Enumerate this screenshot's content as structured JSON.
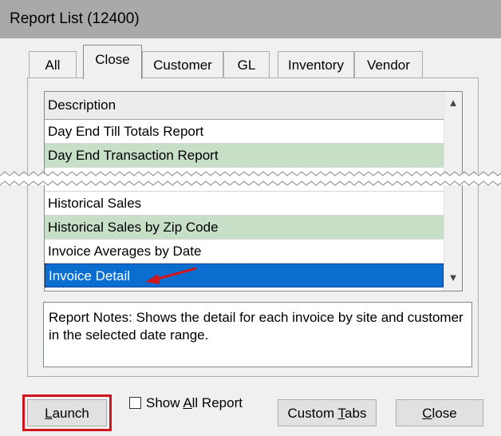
{
  "window": {
    "title": "Report List (12400)"
  },
  "tabs": [
    {
      "label": "All"
    },
    {
      "label": "Close",
      "active": true
    },
    {
      "label": "Customer"
    },
    {
      "label": "GL"
    },
    {
      "label": "Inventory"
    },
    {
      "label": "Vendor"
    }
  ],
  "list": {
    "header": "Description",
    "rows_top": [
      {
        "label": "Day End Till Totals Report",
        "style": "white"
      },
      {
        "label": "Day End Transaction Report",
        "style": "green"
      }
    ],
    "rows_bottom": [
      {
        "label": "Historical Sales",
        "style": "white"
      },
      {
        "label": "Historical Sales by Zip Code",
        "style": "green"
      },
      {
        "label": "Invoice Averages by Date",
        "style": "white"
      },
      {
        "label": "Invoice Detail",
        "style": "selected"
      }
    ],
    "scroll_up_icon": "▲",
    "scroll_down_icon": "▼"
  },
  "notes": {
    "text": "Report Notes:  Shows the detail for each invoice by site and customer in the selected date range."
  },
  "buttons": {
    "launch": {
      "pre": "",
      "accel": "L",
      "post": "aunch"
    },
    "show_all": {
      "pre": "Show ",
      "accel": "A",
      "post": "ll Report",
      "checked": false
    },
    "custom_tabs": {
      "pre": "Custom ",
      "accel": "T",
      "post": "abs"
    },
    "close": {
      "pre": "",
      "accel": "C",
      "post": "lose"
    }
  },
  "colors": {
    "selection": "#0a6ed1",
    "alt_row": "#c6dfc6",
    "highlight_outline": "#d1151c",
    "arrow": "#d1151c"
  }
}
